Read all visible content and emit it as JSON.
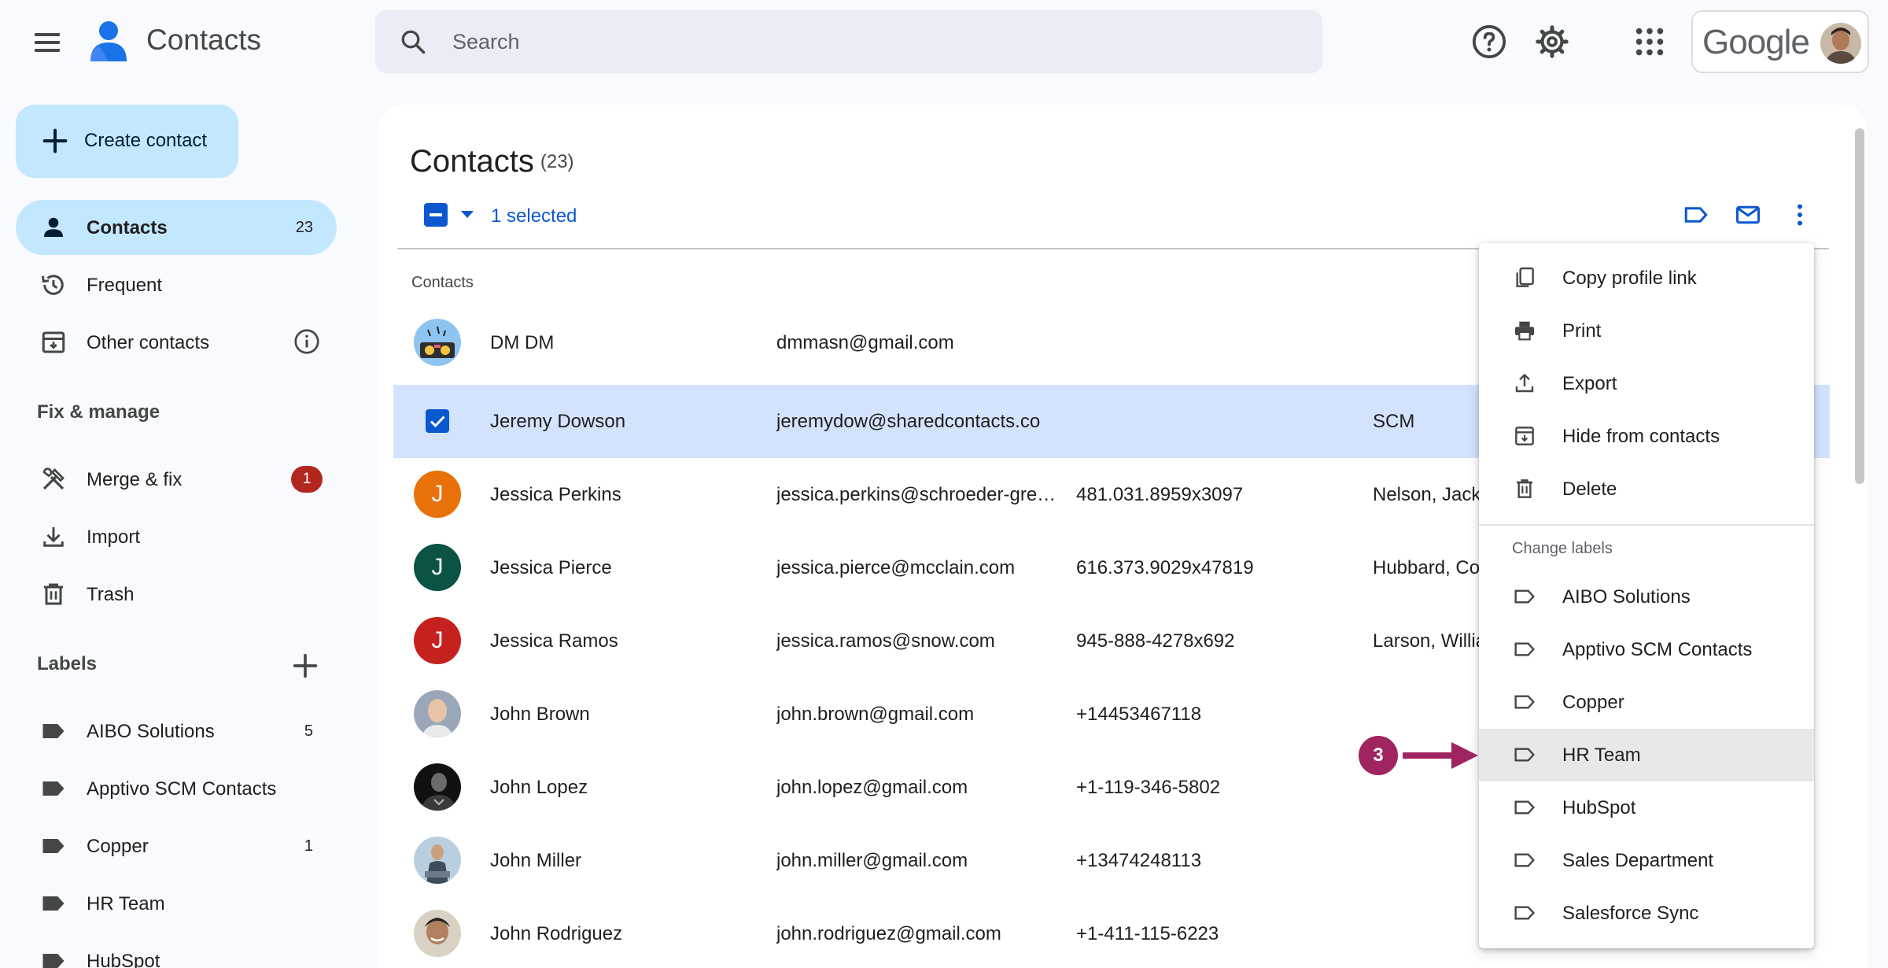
{
  "app": {
    "title": "Contacts",
    "brand": "Google"
  },
  "search": {
    "placeholder": "Search"
  },
  "sidebar": {
    "create_label": "Create contact",
    "nav": [
      {
        "label": "Contacts",
        "count": "23"
      },
      {
        "label": "Frequent"
      },
      {
        "label": "Other contacts"
      }
    ],
    "fix_heading": "Fix & manage",
    "fix": [
      {
        "label": "Merge & fix",
        "badge": "1"
      },
      {
        "label": "Import"
      },
      {
        "label": "Trash"
      }
    ],
    "labels_heading": "Labels",
    "labels": [
      {
        "label": "AIBO Solutions",
        "count": "5"
      },
      {
        "label": "Apptivo SCM Contacts",
        "count": ""
      },
      {
        "label": "Copper",
        "count": "1"
      },
      {
        "label": "HR Team",
        "count": ""
      },
      {
        "label": "HubSpot",
        "count": ""
      }
    ]
  },
  "main": {
    "title": "Contacts",
    "count": "(23)",
    "selected_text": "1 selected",
    "list_heading": "Contacts",
    "contacts": [
      {
        "name": "DM DM",
        "email": "dmmasn@gmail.com",
        "phone": "",
        "company": "",
        "initial": ""
      },
      {
        "name": "Jeremy Dowson",
        "email": "jeremydow@sharedcontacts.co",
        "phone": "",
        "company": "SCM",
        "initial": ""
      },
      {
        "name": "Jessica Perkins",
        "email": "jessica.perkins@schroeder-gree…",
        "phone": "481.031.8959x3097",
        "company": "Nelson, Jack",
        "initial": "J"
      },
      {
        "name": "Jessica Pierce",
        "email": "jessica.pierce@mcclain.com",
        "phone": "616.373.9029x47819",
        "company": "Hubbard, Co",
        "initial": "J"
      },
      {
        "name": "Jessica Ramos",
        "email": "jessica.ramos@snow.com",
        "phone": "945-888-4278x692",
        "company": "Larson, Willia",
        "initial": "J"
      },
      {
        "name": "John Brown",
        "email": "john.brown@gmail.com",
        "phone": "+14453467118",
        "company": "",
        "initial": ""
      },
      {
        "name": "John Lopez",
        "email": "john.lopez@gmail.com",
        "phone": "+1-119-346-5802",
        "company": "",
        "initial": ""
      },
      {
        "name": "John Miller",
        "email": "john.miller@gmail.com",
        "phone": "+13474248113",
        "company": "",
        "initial": ""
      },
      {
        "name": "John Rodriguez",
        "email": "john.rodriguez@gmail.com",
        "phone": "+1-411-115-6223",
        "company": "",
        "initial": ""
      }
    ]
  },
  "menu": {
    "actions": [
      {
        "label": "Copy profile link",
        "icon": "copy-icon"
      },
      {
        "label": "Print",
        "icon": "print-icon"
      },
      {
        "label": "Export",
        "icon": "export-icon"
      },
      {
        "label": "Hide from contacts",
        "icon": "hide-icon"
      },
      {
        "label": "Delete",
        "icon": "delete-icon"
      }
    ],
    "labels_heading": "Change labels",
    "labels": [
      {
        "label": "AIBO Solutions"
      },
      {
        "label": "Apptivo SCM Contacts"
      },
      {
        "label": "Copper"
      },
      {
        "label": "HR Team",
        "highlighted": true
      },
      {
        "label": "HubSpot"
      },
      {
        "label": "Sales Department"
      },
      {
        "label": "Salesforce Sync"
      }
    ]
  },
  "annotation": {
    "step": "3",
    "color": "#a0245f"
  },
  "colors": {
    "accent": "#0b57d0",
    "nav_active": "#c2e7ff",
    "row_selected": "#d3e3fd",
    "badge": "#b3261e"
  }
}
